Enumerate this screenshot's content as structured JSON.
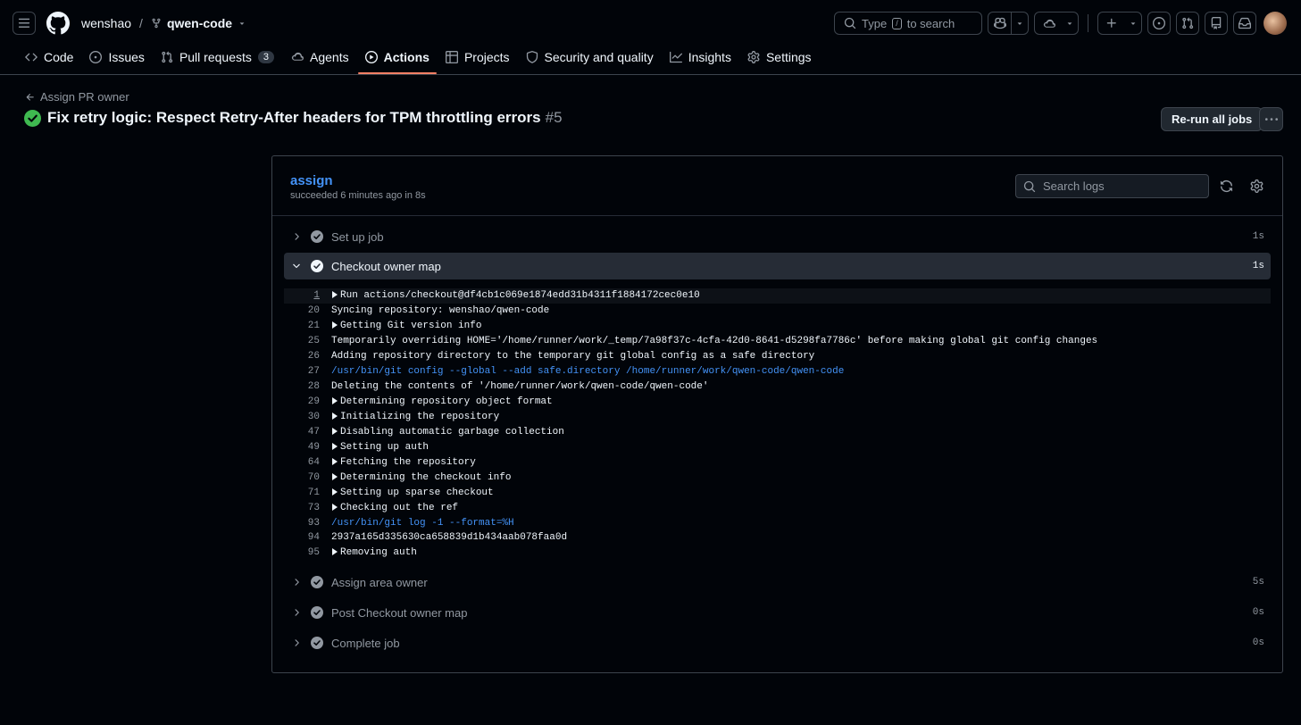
{
  "header": {
    "owner": "wenshao",
    "separator": "/",
    "repo": "qwen-code",
    "search_prefix": "Type",
    "search_key": "/",
    "search_suffix": "to search"
  },
  "nav": {
    "tabs": [
      {
        "label": "Code"
      },
      {
        "label": "Issues"
      },
      {
        "label": "Pull requests",
        "count": "3"
      },
      {
        "label": "Agents"
      },
      {
        "label": "Actions"
      },
      {
        "label": "Projects"
      },
      {
        "label": "Security and quality"
      },
      {
        "label": "Insights"
      },
      {
        "label": "Settings"
      }
    ],
    "active_color": "#f78166"
  },
  "run": {
    "back_label": "Assign PR owner",
    "title": "Fix retry logic: Respect Retry-After headers for TPM throttling errors",
    "number": "#5",
    "rerun_label": "Re-run all jobs",
    "status_color": "#3fb950"
  },
  "job": {
    "name": "assign",
    "summary": "succeeded 6 minutes ago in 8s",
    "search_placeholder": "Search logs"
  },
  "steps": [
    {
      "label": "Set up job",
      "duration": "1s"
    },
    {
      "label": "Checkout owner map",
      "duration": "1s"
    },
    {
      "label": "Assign area owner",
      "duration": "5s"
    },
    {
      "label": "Post Checkout owner map",
      "duration": "0s"
    },
    {
      "label": "Complete job",
      "duration": "0s"
    }
  ],
  "log": [
    {
      "n": "1",
      "text": "Run actions/checkout@df4cb1c069e1874edd31b4311f1884172cec0e10",
      "group": true
    },
    {
      "n": "20",
      "text": "Syncing repository: wenshao/qwen-code"
    },
    {
      "n": "21",
      "text": "Getting Git version info",
      "group": true
    },
    {
      "n": "25",
      "text": "Temporarily overriding HOME='/home/runner/work/_temp/7a98f37c-4cfa-42d0-8641-d5298fa7786c' before making global git config changes"
    },
    {
      "n": "26",
      "text": "Adding repository directory to the temporary git global config as a safe directory"
    },
    {
      "n": "27",
      "text": "/usr/bin/git config --global --add safe.directory /home/runner/work/qwen-code/qwen-code",
      "cmd": true
    },
    {
      "n": "28",
      "text": "Deleting the contents of '/home/runner/work/qwen-code/qwen-code'"
    },
    {
      "n": "29",
      "text": "Determining repository object format",
      "group": true
    },
    {
      "n": "30",
      "text": "Initializing the repository",
      "group": true
    },
    {
      "n": "47",
      "text": "Disabling automatic garbage collection",
      "group": true
    },
    {
      "n": "49",
      "text": "Setting up auth",
      "group": true
    },
    {
      "n": "64",
      "text": "Fetching the repository",
      "group": true
    },
    {
      "n": "70",
      "text": "Determining the checkout info",
      "group": true
    },
    {
      "n": "71",
      "text": "Setting up sparse checkout",
      "group": true
    },
    {
      "n": "73",
      "text": "Checking out the ref",
      "group": true
    },
    {
      "n": "93",
      "text": "/usr/bin/git log -1 --format=%H",
      "cmd": true
    },
    {
      "n": "94",
      "text": "2937a165d335630ca658839d1b434aab078faa0d"
    },
    {
      "n": "95",
      "text": "Removing auth",
      "group": true
    }
  ]
}
